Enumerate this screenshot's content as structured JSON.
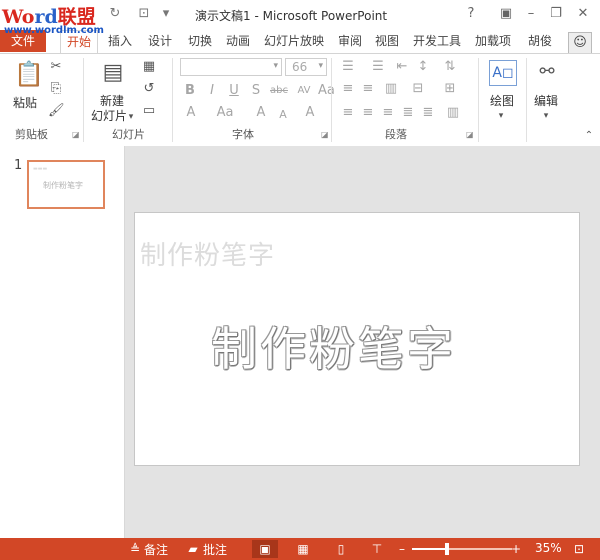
{
  "window": {
    "title": "演示文稿1 - Microsoft PowerPoint"
  },
  "logo": {
    "w1": "Wo",
    "w2": "rd",
    "w3": "联盟",
    "url": "www.wordlm.com"
  },
  "tabs": {
    "file": "文件",
    "items": [
      "开始",
      "插入",
      "设计",
      "切换",
      "动画",
      "幻灯片放映",
      "审阅",
      "视图",
      "开发工具",
      "加载项"
    ],
    "user": "胡俊"
  },
  "ribbon": {
    "clipboard": {
      "paste": "粘贴",
      "group": "剪贴板"
    },
    "slides": {
      "new_slide_line1": "新建",
      "new_slide_line2": "幻灯片",
      "group": "幻灯片"
    },
    "font": {
      "name": "",
      "size": "66",
      "group": "字体"
    },
    "paragraph": {
      "group": "段落"
    },
    "drawing": {
      "label": "绘图"
    },
    "editing": {
      "label": "编辑"
    }
  },
  "thumbnail": {
    "number": "1",
    "text": "制作粉笔字"
  },
  "slide": {
    "title_placeholder": "制作粉笔字",
    "chalk_text": "制作粉笔字"
  },
  "status": {
    "notes": "备注",
    "comments": "批注",
    "zoom": "35%",
    "zoom_level": 0.35
  },
  "colors": {
    "accent": "#d24726"
  }
}
